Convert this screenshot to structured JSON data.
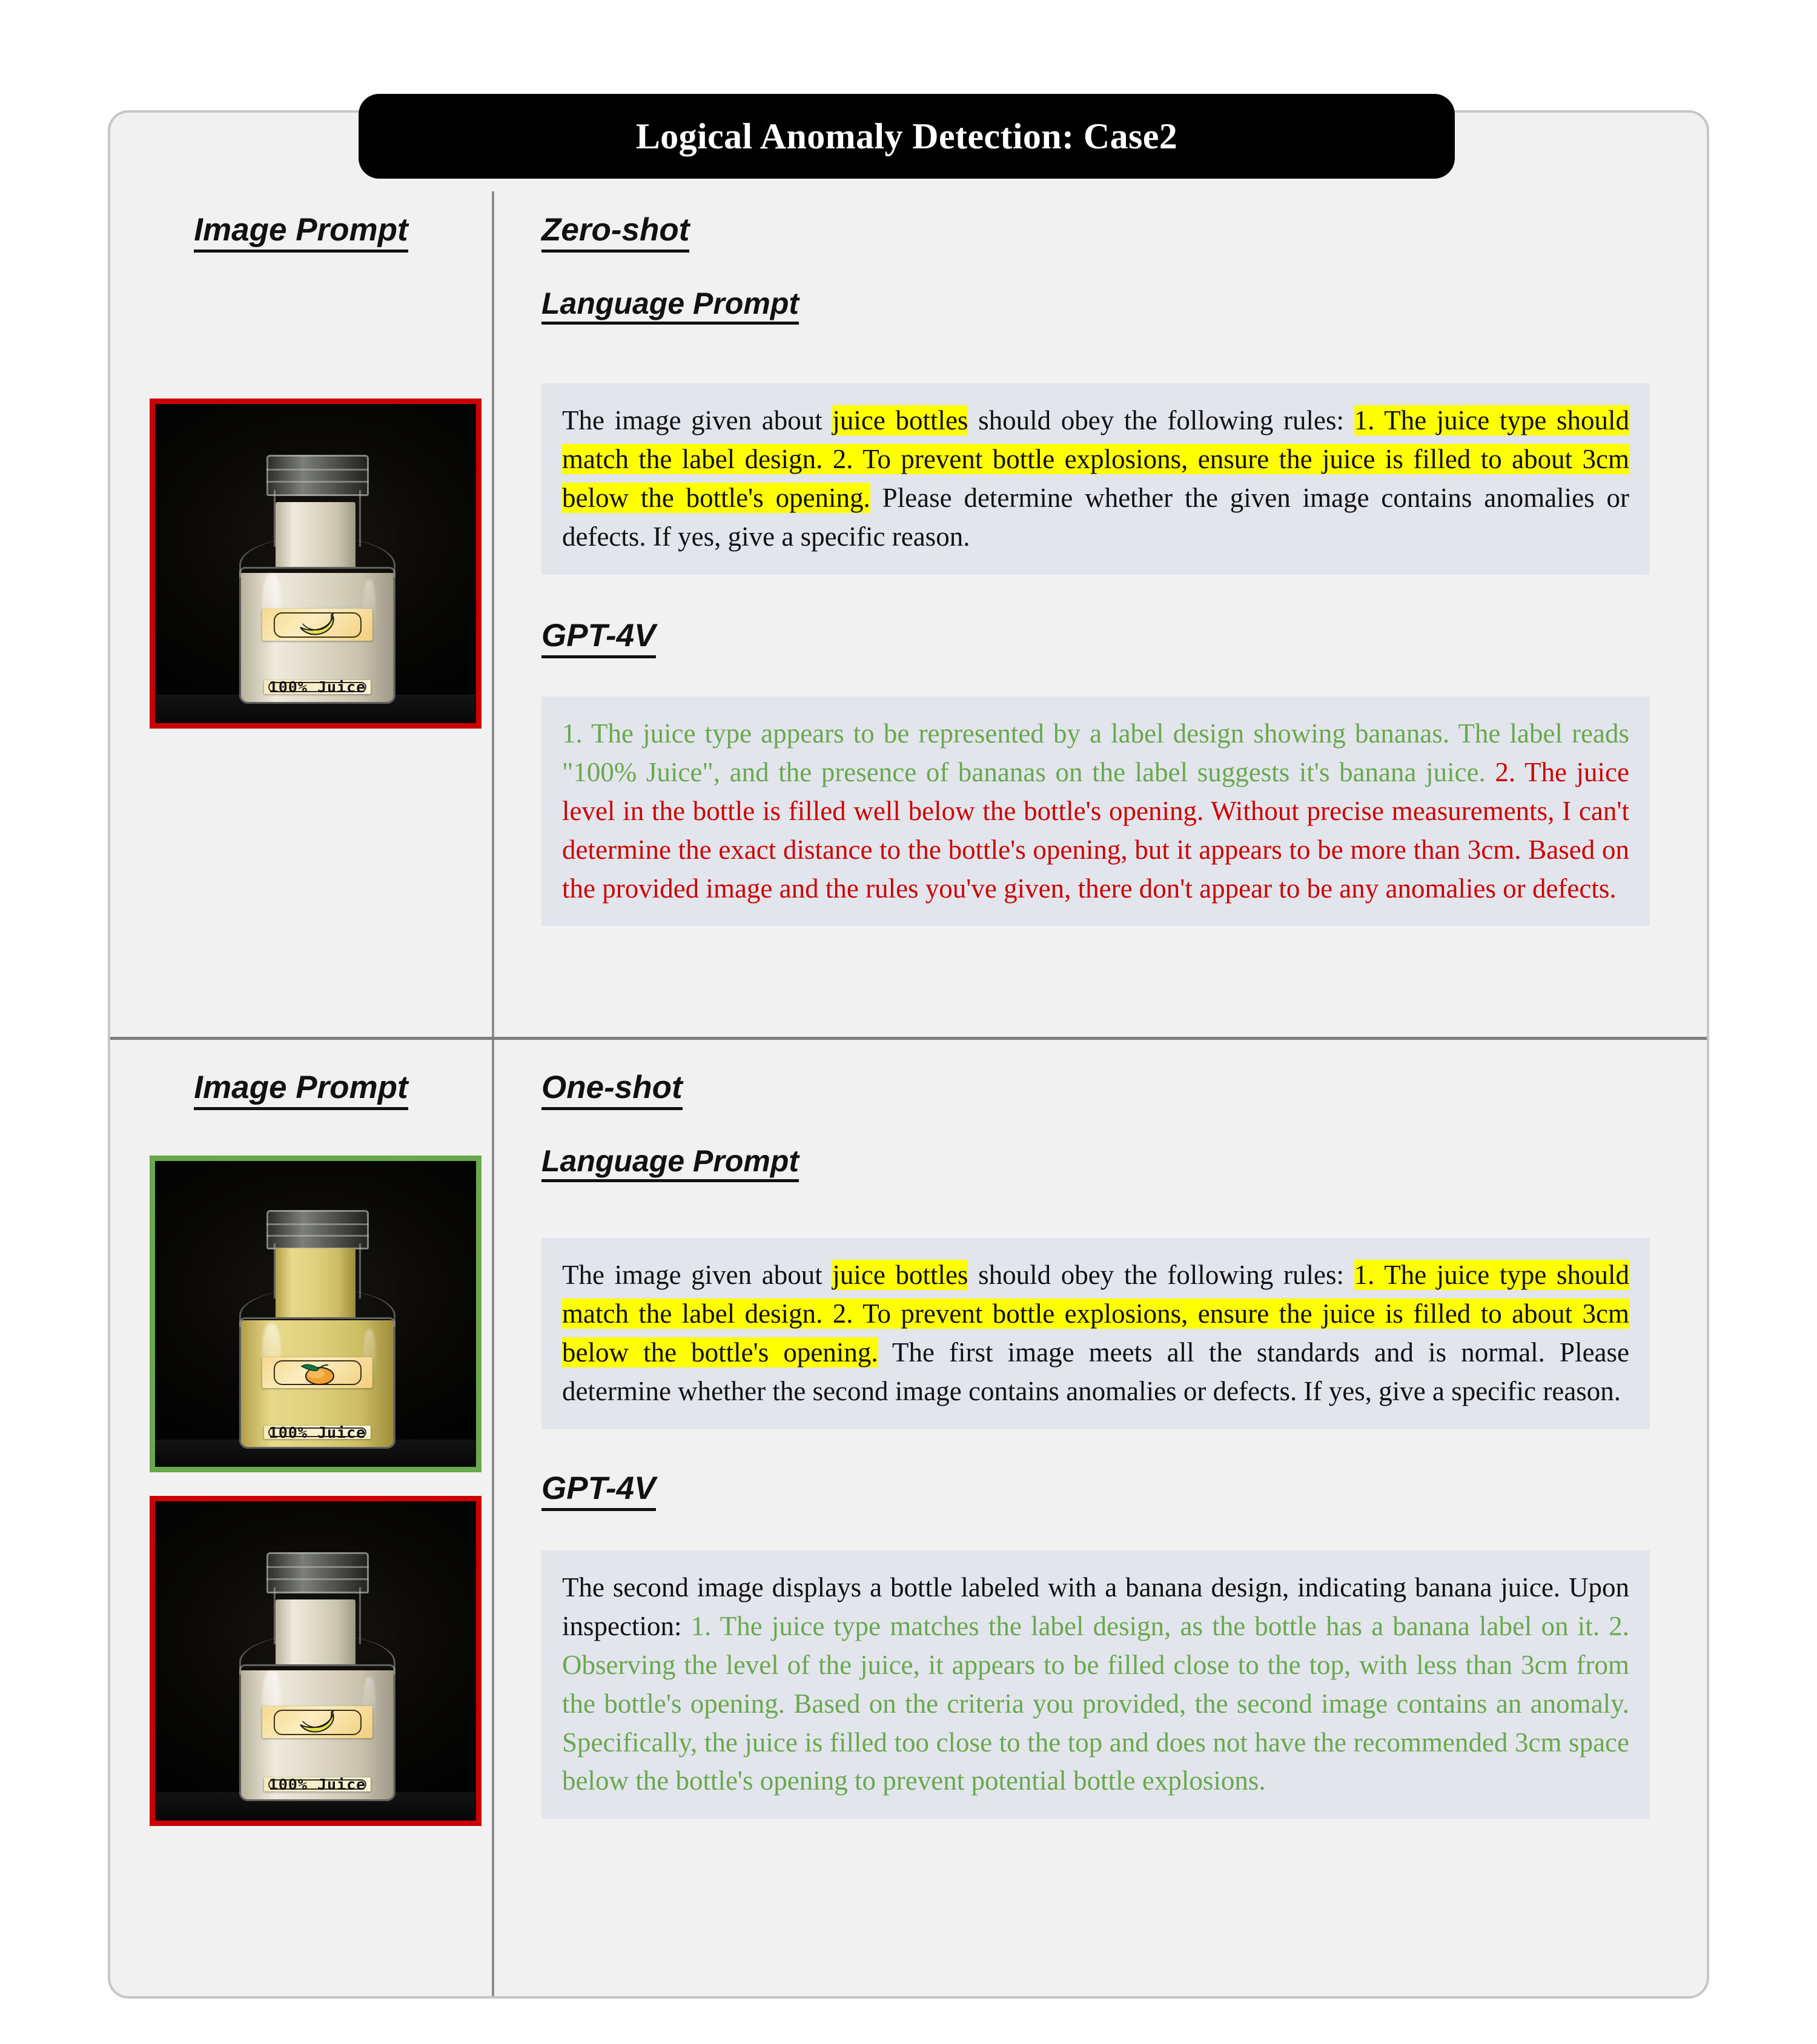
{
  "figure": {
    "title": "Logical Anomaly Detection: Case2"
  },
  "sections": [
    {
      "id": "zero-shot",
      "image_prompt_heading": "Image Prompt",
      "shot_heading": "Zero-shot",
      "language_prompt_heading": "Language Prompt",
      "model_heading": "GPT-4V",
      "images": [
        {
          "border_color": "#cc0000",
          "label_fruit": "banana",
          "label_text": "100% Juice",
          "juice_color": "milky-white",
          "fill_level": "below-neck"
        }
      ],
      "prompt_parts": [
        {
          "text": "The image given about ",
          "style": "plain"
        },
        {
          "text": "juice bottles",
          "style": "highlight"
        },
        {
          "text": " should obey the following rules: ",
          "style": "plain"
        },
        {
          "text": "1. The juice type should match the label design. 2. To prevent bottle explosions, ensure the juice is filled to about 3cm below the bottle's opening.",
          "style": "highlight"
        },
        {
          "text": " Please determine whether the given image contains anomalies or defects. If yes, give a specific reason.",
          "style": "plain"
        }
      ],
      "response_parts": [
        {
          "text": "1. The juice type appears to be represented by a label design showing bananas. The label reads \"100% Juice\", and the presence of bananas on the label suggests it's banana juice. ",
          "style": "green"
        },
        {
          "text": "2. The juice level in the bottle is filled well below the bottle's opening. Without precise measurements, I can't determine the exact distance to the bottle's opening, but it appears to be more than 3cm. Based on the provided image and the rules you've given, there don't appear to be any anomalies or defects.",
          "style": "red"
        }
      ]
    },
    {
      "id": "one-shot",
      "image_prompt_heading": "Image Prompt",
      "shot_heading": "One-shot",
      "language_prompt_heading": "Language Prompt",
      "model_heading": "GPT-4V",
      "images": [
        {
          "border_color": "#6aa84f",
          "label_fruit": "orange",
          "label_text": "100% Juice",
          "juice_color": "yellow",
          "fill_level": "up-to-neck"
        },
        {
          "border_color": "#cc0000",
          "label_fruit": "banana",
          "label_text": "100% Juice",
          "juice_color": "milky-white",
          "fill_level": "below-neck"
        }
      ],
      "prompt_parts": [
        {
          "text": "The image given about ",
          "style": "plain"
        },
        {
          "text": "juice bottles",
          "style": "highlight"
        },
        {
          "text": " should obey the following rules: ",
          "style": "plain"
        },
        {
          "text": "1. The juice type should match the label design. 2. To prevent bottle explosions, ensure the juice is filled to about 3cm below the bottle's opening.",
          "style": "highlight"
        },
        {
          "text": " The first image meets all the standards and is normal. Please determine whether the second image contains anomalies or defects. If yes, give a specific reason.",
          "style": "plain"
        }
      ],
      "response_parts": [
        {
          "text": "The second image displays a bottle labeled with a banana design, indicating banana juice. Upon inspection:",
          "style": "plain"
        },
        {
          "text": " 1. The juice type matches the label design, as the bottle has a banana label on it. 2. Observing the level of the juice, it appears to be filled close to the top, with less than 3cm from the bottle's opening. Based on the criteria you provided, the second image contains an anomaly. Specifically, the juice is filled too close to the top and does not have the recommended 3cm space below the bottle's opening to prevent potential bottle explosions.",
          "style": "green"
        }
      ]
    }
  ],
  "colors": {
    "highlight": "#ffff00",
    "correct": "#6aa84f",
    "incorrect": "#cc0000",
    "panel_bg": "#f1f1f1",
    "textbox_bg": "#e2e6ec",
    "banner_bg": "#000000"
  }
}
